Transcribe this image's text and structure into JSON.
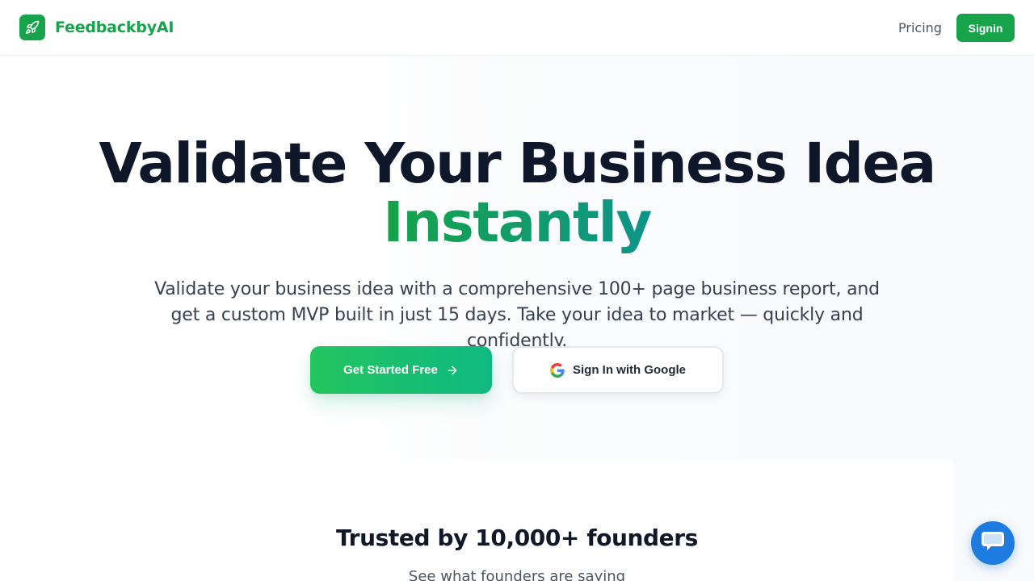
{
  "brand": {
    "name": "FeedbackbyAI",
    "icon": "rocket-icon",
    "color": "#16a34a"
  },
  "nav": {
    "pricing_label": "Pricing",
    "signin_label": "Signin"
  },
  "hero": {
    "title": "Validate Your Business Idea",
    "title_accent": "Instantly",
    "subtitle": "Validate your business idea with a comprehensive 100+ page business report, and get a custom MVP built in just 15 days. Take your idea to market — quickly and confidently.",
    "primary_cta": "Get Started Free",
    "google_cta": "Sign In with Google",
    "accent_gradient": [
      "#16a34a",
      "#0d9488"
    ]
  },
  "trusted": {
    "title": "Trusted by 10,000+ founders",
    "subtitle": "See what founders are saying"
  },
  "chat": {
    "icon": "chat-bubble-icon",
    "color": "#1e7be0"
  }
}
